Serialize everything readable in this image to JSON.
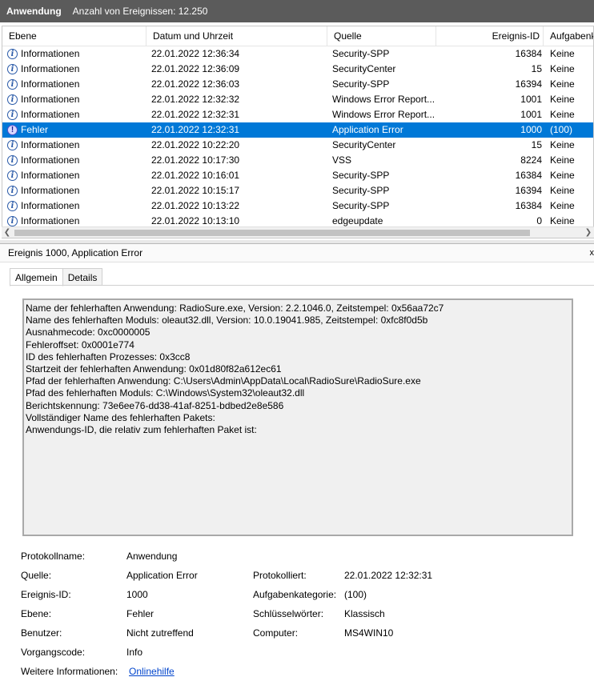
{
  "header": {
    "title": "Anwendung",
    "count": "Anzahl von Ereignissen: 12.250"
  },
  "columns": {
    "level": "Ebene",
    "date": "Datum und Uhrzeit",
    "source": "Quelle",
    "id": "Ereignis-ID",
    "task": "Aufgabenk"
  },
  "events": [
    {
      "level": "Informationen",
      "date": "22.01.2022 12:36:34",
      "source": "Security-SPP",
      "id": "16384",
      "task": "Keine",
      "icon": "info-icon"
    },
    {
      "level": "Informationen",
      "date": "22.01.2022 12:36:09",
      "source": "SecurityCenter",
      "id": "15",
      "task": "Keine",
      "icon": "info-icon"
    },
    {
      "level": "Informationen",
      "date": "22.01.2022 12:36:03",
      "source": "Security-SPP",
      "id": "16394",
      "task": "Keine",
      "icon": "info-icon"
    },
    {
      "level": "Informationen",
      "date": "22.01.2022 12:32:32",
      "source": "Windows Error Report...",
      "id": "1001",
      "task": "Keine",
      "icon": "info-icon"
    },
    {
      "level": "Informationen",
      "date": "22.01.2022 12:32:31",
      "source": "Windows Error Report...",
      "id": "1001",
      "task": "Keine",
      "icon": "info-icon"
    },
    {
      "level": "Fehler",
      "date": "22.01.2022 12:32:31",
      "source": "Application Error",
      "id": "1000",
      "task": "(100)",
      "icon": "error-icon",
      "selected": true
    },
    {
      "level": "Informationen",
      "date": "22.01.2022 10:22:20",
      "source": "SecurityCenter",
      "id": "15",
      "task": "Keine",
      "icon": "info-icon"
    },
    {
      "level": "Informationen",
      "date": "22.01.2022 10:17:30",
      "source": "VSS",
      "id": "8224",
      "task": "Keine",
      "icon": "info-icon"
    },
    {
      "level": "Informationen",
      "date": "22.01.2022 10:16:01",
      "source": "Security-SPP",
      "id": "16384",
      "task": "Keine",
      "icon": "info-icon"
    },
    {
      "level": "Informationen",
      "date": "22.01.2022 10:15:17",
      "source": "Security-SPP",
      "id": "16394",
      "task": "Keine",
      "icon": "info-icon"
    },
    {
      "level": "Informationen",
      "date": "22.01.2022 10:13:22",
      "source": "Security-SPP",
      "id": "16384",
      "task": "Keine",
      "icon": "info-icon"
    },
    {
      "level": "Informationen",
      "date": "22.01.2022 10:13:10",
      "source": "edgeupdate",
      "id": "0",
      "task": "Keine",
      "icon": "info-icon"
    }
  ],
  "detail": {
    "title": "Ereignis 1000, Application Error",
    "close": "x",
    "tabs": {
      "general": "Allgemein",
      "details": "Details"
    },
    "description": [
      "Name der fehlerhaften Anwendung: RadioSure.exe, Version: 2.2.1046.0, Zeitstempel: 0x56aa72c7",
      "Name des fehlerhaften Moduls: oleaut32.dll, Version: 10.0.19041.985, Zeitstempel: 0xfc8f0d5b",
      "Ausnahmecode: 0xc0000005",
      "Fehleroffset: 0x0001e774",
      "ID des fehlerhaften Prozesses: 0x3cc8",
      "Startzeit der fehlerhaften Anwendung: 0x01d80f82a612ec61",
      "Pfad der fehlerhaften Anwendung: C:\\Users\\Admin\\AppData\\Local\\RadioSure\\RadioSure.exe",
      "Pfad des fehlerhaften Moduls: C:\\Windows\\System32\\oleaut32.dll",
      "Berichtskennung: 73e6ee76-dd38-41af-8251-bdbed2e8e586",
      "Vollständiger Name des fehlerhaften Pakets:",
      "Anwendungs-ID, die relativ zum fehlerhaften Paket ist:"
    ],
    "props": {
      "log_name_label": "Protokollname:",
      "log_name": "Anwendung",
      "source_label": "Quelle:",
      "source": "Application Error",
      "logged_label": "Protokolliert:",
      "logged": "22.01.2022 12:32:31",
      "event_id_label": "Ereignis-ID:",
      "event_id": "1000",
      "task_label": "Aufgabenkategorie:",
      "task": "(100)",
      "level_label": "Ebene:",
      "level": "Fehler",
      "keywords_label": "Schlüsselwörter:",
      "keywords": "Klassisch",
      "user_label": "Benutzer:",
      "user": "Nicht zutreffend",
      "computer_label": "Computer:",
      "computer": "MS4WIN10",
      "opcode_label": "Vorgangscode:",
      "opcode": "Info",
      "more_info_label": "Weitere Informationen:",
      "more_info_link": "Onlinehilfe"
    }
  },
  "colors": {
    "selection": "#0078d7",
    "titlebar": "#5b5b5b",
    "link": "#0044cc"
  }
}
